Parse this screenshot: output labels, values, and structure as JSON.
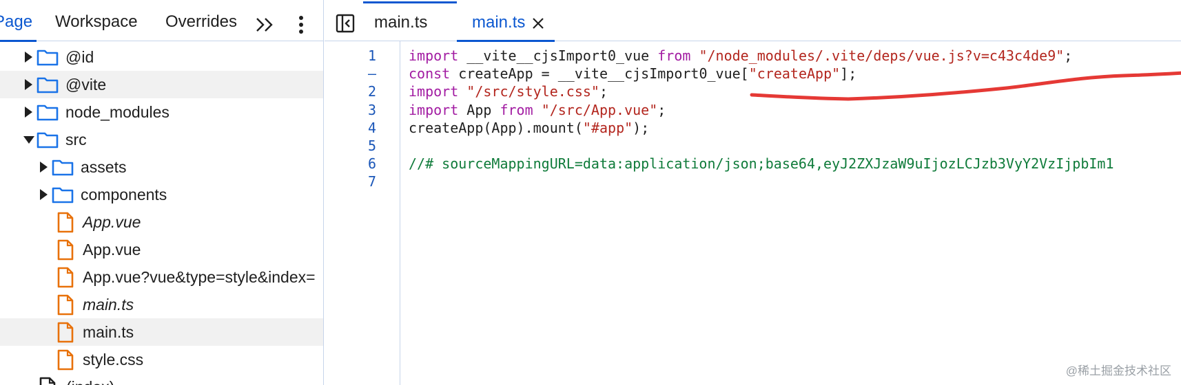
{
  "left_panel": {
    "tabs": [
      {
        "label": "Page",
        "active": true
      },
      {
        "label": "Workspace",
        "active": false
      },
      {
        "label": "Overrides",
        "active": false
      }
    ],
    "more_tabs_label": ">>",
    "tree": [
      {
        "label": "@id",
        "kind": "folder",
        "expander": "collapsed",
        "depth": 1,
        "italic": false,
        "highlighted": false
      },
      {
        "label": "@vite",
        "kind": "folder",
        "expander": "collapsed",
        "depth": 1,
        "italic": false,
        "highlighted": true
      },
      {
        "label": "node_modules",
        "kind": "folder",
        "expander": "collapsed",
        "depth": 1,
        "italic": false,
        "highlighted": false
      },
      {
        "label": "src",
        "kind": "folder",
        "expander": "expanded",
        "depth": 1,
        "italic": false,
        "highlighted": false
      },
      {
        "label": "assets",
        "kind": "folder",
        "expander": "collapsed",
        "depth": 2,
        "italic": false,
        "highlighted": false
      },
      {
        "label": "components",
        "kind": "folder",
        "expander": "collapsed",
        "depth": 2,
        "italic": false,
        "highlighted": false
      },
      {
        "label": "App.vue",
        "kind": "file",
        "expander": "none",
        "depth": 2,
        "italic": true,
        "highlighted": false
      },
      {
        "label": "App.vue",
        "kind": "file",
        "expander": "none",
        "depth": 2,
        "italic": false,
        "highlighted": false
      },
      {
        "label": "App.vue?vue&type=style&index=",
        "kind": "file",
        "expander": "none",
        "depth": 2,
        "italic": false,
        "highlighted": false
      },
      {
        "label": "main.ts",
        "kind": "file",
        "expander": "none",
        "depth": 2,
        "italic": true,
        "highlighted": false
      },
      {
        "label": "main.ts",
        "kind": "file",
        "expander": "none",
        "depth": 2,
        "italic": false,
        "highlighted": true
      },
      {
        "label": "style.css",
        "kind": "file",
        "expander": "none",
        "depth": 2,
        "italic": false,
        "highlighted": false
      },
      {
        "label": "(index)",
        "kind": "document",
        "expander": "none",
        "depth": 1,
        "italic": false,
        "highlighted": false
      }
    ]
  },
  "editor": {
    "tabs": [
      {
        "label": "main.ts",
        "active": false,
        "closable": false
      },
      {
        "label": "main.ts",
        "active": true,
        "closable": true
      }
    ],
    "close_label": "✕",
    "gutter": [
      "1",
      "–",
      "2",
      "3",
      "4",
      "5",
      "6",
      "7"
    ],
    "code_lines": [
      [
        {
          "t": "import",
          "c": "kw"
        },
        {
          "t": " ",
          "c": "tk"
        },
        {
          "t": "__vite__cjsImport0_vue",
          "c": "id"
        },
        {
          "t": " ",
          "c": "tk"
        },
        {
          "t": "from",
          "c": "kw"
        },
        {
          "t": " ",
          "c": "tk"
        },
        {
          "t": "\"/node_modules/.vite/deps/vue.js?v=c43c4de9\"",
          "c": "str"
        },
        {
          "t": ";",
          "c": "tk"
        }
      ],
      [
        {
          "t": "const",
          "c": "kw"
        },
        {
          "t": " ",
          "c": "tk"
        },
        {
          "t": "createApp",
          "c": "id"
        },
        {
          "t": " = ",
          "c": "tk"
        },
        {
          "t": "__vite__cjsImport0_vue",
          "c": "id"
        },
        {
          "t": "[",
          "c": "tk"
        },
        {
          "t": "\"createApp\"",
          "c": "str"
        },
        {
          "t": "];",
          "c": "tk"
        }
      ],
      [
        {
          "t": "import",
          "c": "kw"
        },
        {
          "t": " ",
          "c": "tk"
        },
        {
          "t": "\"/src/style.css\"",
          "c": "str"
        },
        {
          "t": ";",
          "c": "tk"
        }
      ],
      [
        {
          "t": "import",
          "c": "kw"
        },
        {
          "t": " ",
          "c": "tk"
        },
        {
          "t": "App",
          "c": "id"
        },
        {
          "t": " ",
          "c": "tk"
        },
        {
          "t": "from",
          "c": "kw"
        },
        {
          "t": " ",
          "c": "tk"
        },
        {
          "t": "\"/src/App.vue\"",
          "c": "str"
        },
        {
          "t": ";",
          "c": "tk"
        }
      ],
      [
        {
          "t": "createApp",
          "c": "id"
        },
        {
          "t": "(",
          "c": "tk"
        },
        {
          "t": "App",
          "c": "id"
        },
        {
          "t": ").",
          "c": "tk"
        },
        {
          "t": "mount",
          "c": "id"
        },
        {
          "t": "(",
          "c": "tk"
        },
        {
          "t": "\"#app\"",
          "c": "str"
        },
        {
          "t": ");",
          "c": "tk"
        }
      ],
      [],
      [
        {
          "t": "//# sourceMappingURL=data:application/json;base64,eyJ2ZXJzaW9uIjozLCJzb3VyY2VzIjpbIm1",
          "c": "cm"
        }
      ],
      []
    ]
  },
  "colors": {
    "accent": "#0b57d0",
    "folder": "#1a73e8",
    "file": "#e8710a",
    "keyword": "#a21ca2",
    "string": "#b3261e",
    "comment": "#0f7b3a",
    "annotation": "#e53935"
  },
  "icons": {
    "folder": "folder-icon",
    "file": "file-icon",
    "document": "document-icon",
    "sidebar_toggle": "sidebar-toggle-icon",
    "more": "kebab-menu-icon",
    "overflow": "double-chevron-icon"
  },
  "watermark": "@稀土掘金技术社区"
}
